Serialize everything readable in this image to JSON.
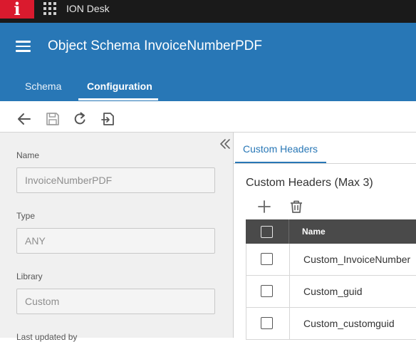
{
  "topbar": {
    "logo_letter": "i",
    "app_title": "ION Desk"
  },
  "header": {
    "title": "Object Schema InvoiceNumberPDF"
  },
  "tabs": [
    {
      "label": "Schema",
      "active": false
    },
    {
      "label": "Configuration",
      "active": true
    }
  ],
  "form": {
    "name_label": "Name",
    "name_value": "InvoiceNumberPDF",
    "type_label": "Type",
    "type_value": "ANY",
    "library_label": "Library",
    "library_value": "Custom",
    "last_updated_label": "Last updated by"
  },
  "right": {
    "tab_label": "Custom Headers",
    "section_title": "Custom Headers (Max 3)",
    "table": {
      "column_name": "Name",
      "rows": [
        {
          "name": "Custom_InvoiceNumber"
        },
        {
          "name": "Custom_guid"
        },
        {
          "name": "Custom_customguid"
        }
      ]
    }
  },
  "colors": {
    "brand_red": "#da1a2e",
    "header_blue": "#2877b6",
    "topbar_dark": "#1a1a1a",
    "table_header": "#4a4a4a"
  },
  "icons": [
    "apps-grid-icon",
    "hamburger-menu-icon",
    "back-arrow-icon",
    "save-icon",
    "refresh-icon",
    "import-icon",
    "collapse-left-icon",
    "add-icon",
    "delete-icon"
  ]
}
